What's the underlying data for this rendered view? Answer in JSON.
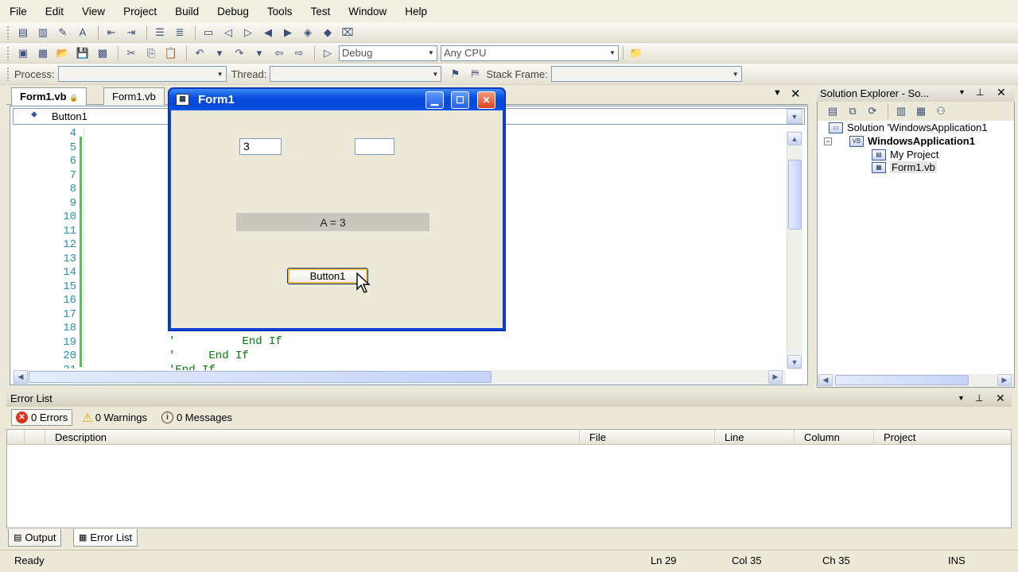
{
  "menu": [
    "File",
    "Edit",
    "View",
    "Project",
    "Build",
    "Debug",
    "Tools",
    "Test",
    "Window",
    "Help"
  ],
  "toolbar": {
    "configuration": "Debug",
    "platform": "Any CPU",
    "process_label": "Process:",
    "thread_label": "Thread:",
    "stack_frame_label": "Stack Frame:"
  },
  "editor": {
    "tabs": [
      "Form1.vb",
      "Form1.vb"
    ],
    "object_combo": "Button1",
    "line_numbers": [
      "4",
      "5",
      "6",
      "7",
      "8",
      "9",
      "10",
      "11",
      "12",
      "13",
      "14",
      "15",
      "16",
      "17",
      "18",
      "19",
      "20",
      "21"
    ],
    "code_lines": {
      "line19": "'          End If",
      "line20": "'     End If",
      "line21": "'End If"
    }
  },
  "form_window": {
    "title": "Form1",
    "textbox1_value": "3",
    "textbox2_value": "",
    "label_text": "A = 3",
    "button_label": "Button1"
  },
  "solution_explorer": {
    "title": "Solution Explorer - So...",
    "solution": "Solution 'WindowsApplication1",
    "project": "WindowsApplication1",
    "my_project": "My Project",
    "file": "Form1.vb"
  },
  "error_list": {
    "title": "Error List",
    "errors": "0 Errors",
    "warnings": "0 Warnings",
    "messages": "0 Messages",
    "columns": [
      "Description",
      "File",
      "Line",
      "Column",
      "Project"
    ],
    "bottom_tabs": [
      "Output",
      "Error List"
    ]
  },
  "status": {
    "ready": "Ready",
    "ln": "Ln 29",
    "col": "Col 35",
    "ch": "Ch 35",
    "ins": "INS"
  },
  "colors": {
    "title_bar": "#0a4ee0",
    "code_comment": "#008000",
    "line_number": "#2b91af",
    "error_badge": "#d9331f"
  }
}
